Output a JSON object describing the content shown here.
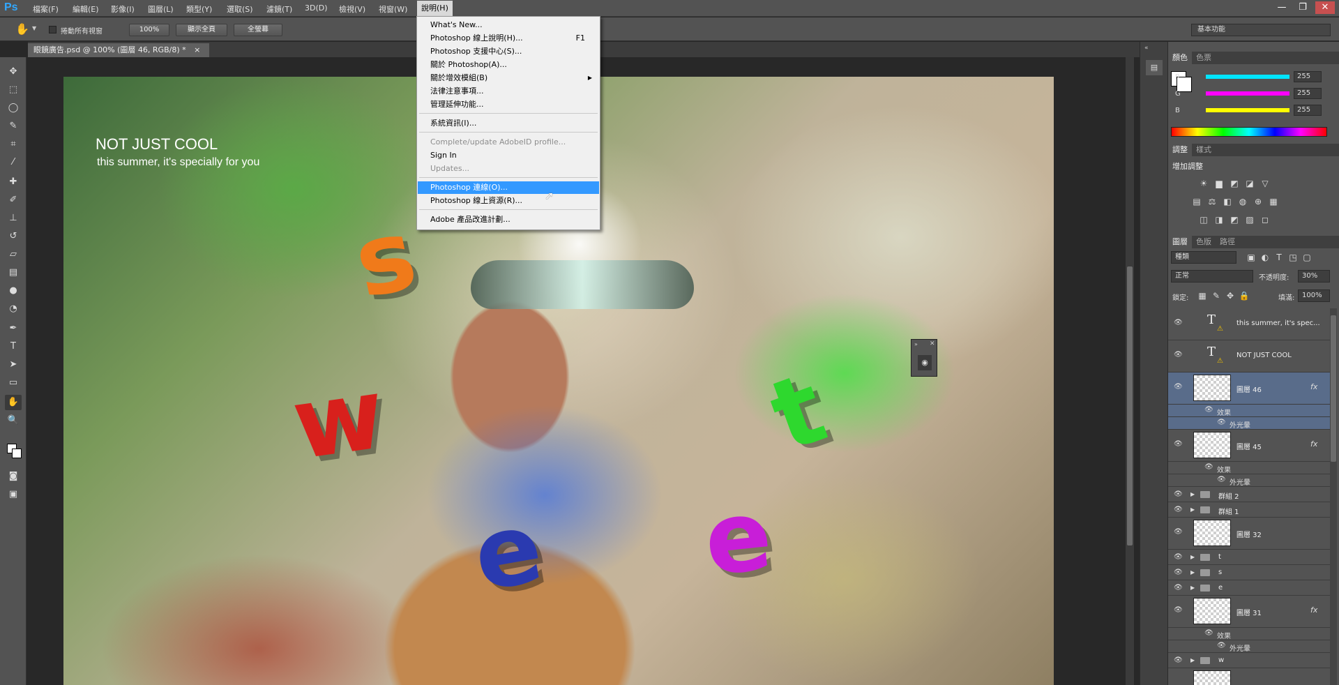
{
  "app": {
    "logo": "Ps"
  },
  "menubar": {
    "items": [
      "檔案(F)",
      "編輯(E)",
      "影像(I)",
      "圖層(L)",
      "類型(Y)",
      "選取(S)",
      "濾鏡(T)",
      "3D(D)",
      "檢視(V)",
      "視窗(W)",
      "說明(H)"
    ]
  },
  "window_controls": {
    "minimize": "—",
    "restore": "❐",
    "close": "✕"
  },
  "options_bar": {
    "tool_icon": "hand-icon",
    "scroll_all_label": "捲動所有視窗",
    "zoom_100": "100%",
    "fit_screen": "顯示全頁",
    "fill_screen": "全螢幕",
    "workspace": "基本功能"
  },
  "document_tab": {
    "title": "眼鏡廣告.psd @ 100% (圖層 46, RGB/8) *",
    "close": "×"
  },
  "artwork": {
    "title": "NOT JUST COOL",
    "subtitle": "this summer, it's specially for you"
  },
  "help_menu": {
    "items": [
      {
        "label": "What's New...",
        "shortcut": "",
        "disabled": false
      },
      {
        "label": "Photoshop 線上說明(H)...",
        "shortcut": "F1",
        "disabled": false
      },
      {
        "label": "Photoshop 支援中心(S)...",
        "shortcut": "",
        "disabled": false
      },
      {
        "label": "關於 Photoshop(A)...",
        "shortcut": "",
        "disabled": false
      },
      {
        "label": "關於增效模組(B)",
        "shortcut": "",
        "disabled": false,
        "submenu": true
      },
      {
        "label": "法律注意事項...",
        "shortcut": "",
        "disabled": false
      },
      {
        "label": "管理延伸功能...",
        "shortcut": "",
        "disabled": false
      },
      {
        "label": "系統資訊(I)...",
        "shortcut": "",
        "disabled": false
      },
      {
        "label": "Complete/update AdobeID profile...",
        "shortcut": "",
        "disabled": true
      },
      {
        "label": "Sign In",
        "shortcut": "",
        "disabled": false
      },
      {
        "label": "Updates...",
        "shortcut": "",
        "disabled": true
      },
      {
        "label": "Photoshop 連線(O)...",
        "shortcut": "",
        "disabled": false,
        "highlighted": true
      },
      {
        "label": "Photoshop 線上資源(R)...",
        "shortcut": "",
        "disabled": false
      },
      {
        "label": "Adobe 產品改進計劃...",
        "shortcut": "",
        "disabled": false
      }
    ],
    "submenu_arrow": "▶"
  },
  "color_panel": {
    "tabs": [
      "顏色",
      "色票"
    ],
    "channels": [
      {
        "label": "R",
        "value": "255",
        "color": "#00e5ff"
      },
      {
        "label": "G",
        "value": "255",
        "color": "#ff00ff"
      },
      {
        "label": "B",
        "value": "255",
        "color": "#ffff00"
      }
    ]
  },
  "adjust_panel": {
    "tabs": [
      "調整",
      "樣式"
    ],
    "heading": "增加調整",
    "icons": [
      "☀",
      "▆",
      "◩",
      "◪",
      "▽",
      "▤",
      "⚖",
      "◧",
      "◍",
      "⊕",
      "▦",
      "◫",
      "◨",
      "◩",
      "▨",
      "◻"
    ]
  },
  "layers_panel": {
    "tabs": [
      "圖層",
      "色版",
      "路徑"
    ],
    "filter_label": "種類",
    "filter_icons": [
      "▣",
      "◐",
      "T",
      "◳",
      "▢"
    ],
    "blend_mode": "正常",
    "opacity_label": "不透明度:",
    "opacity_value": "30%",
    "lock_label": "鎖定:",
    "lock_icons": [
      "▦",
      "✎",
      "✥",
      "🔒"
    ],
    "fill_label": "填滿:",
    "fill_value": "100%",
    "eye": "👁",
    "expander": "▶",
    "text_glyph": "T",
    "warn": "⚠",
    "fx": "fx",
    "effects_label": "效果",
    "outer_glow_label": "外光暈",
    "layers": [
      {
        "name": "this summer, it's spec...",
        "kind": "text"
      },
      {
        "name": "NOT JUST COOL",
        "kind": "text"
      },
      {
        "name": "圖層 46",
        "kind": "pixel",
        "selected": true,
        "fx": true
      },
      {
        "name": "圖層 45",
        "kind": "pixel",
        "fx": true
      },
      {
        "name": "群組 2",
        "kind": "group"
      },
      {
        "name": "群組 1",
        "kind": "group"
      },
      {
        "name": "圖層 32",
        "kind": "pixel"
      },
      {
        "name": "t",
        "kind": "group"
      },
      {
        "name": "s",
        "kind": "group"
      },
      {
        "name": "e",
        "kind": "group"
      },
      {
        "name": "圖層 31",
        "kind": "pixel",
        "fx": true
      },
      {
        "name": "w",
        "kind": "group"
      }
    ]
  },
  "colors": {
    "accent": "#3399ff",
    "panel": "#535353",
    "selected_layer": "#596c8a"
  }
}
